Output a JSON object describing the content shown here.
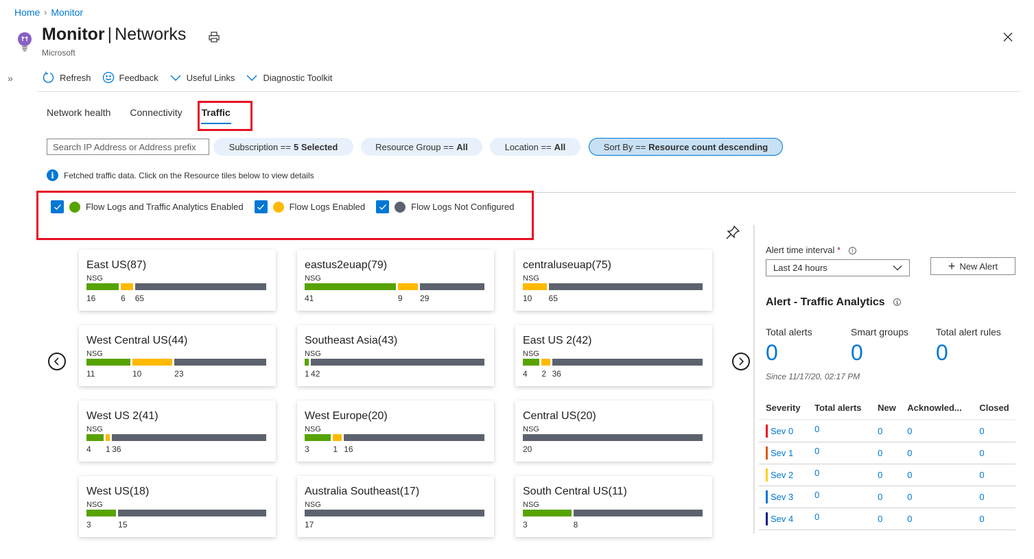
{
  "breadcrumb": [
    {
      "label": "Home"
    },
    {
      "label": "Monitor"
    }
  ],
  "header": {
    "title_main": "Monitor",
    "title_section": "Networks",
    "subtitle": "Microsoft"
  },
  "toolbar": {
    "refresh": "Refresh",
    "feedback": "Feedback",
    "useful_links": "Useful Links",
    "diagnostic_toolkit": "Diagnostic Toolkit"
  },
  "tabs": [
    {
      "label": "Network health",
      "active": false
    },
    {
      "label": "Connectivity",
      "active": false
    },
    {
      "label": "Traffic",
      "active": true
    }
  ],
  "filters": {
    "search_placeholder": "Search IP Address or Address prefix",
    "subscription": {
      "label": "Subscription ==",
      "value": "5 Selected"
    },
    "resource_group": {
      "label": "Resource Group ==",
      "value": "All"
    },
    "location": {
      "label": "Location ==",
      "value": "All"
    },
    "sort_by": {
      "label": "Sort By ==",
      "value": "Resource count descending"
    }
  },
  "info_message": "Fetched traffic data. Click on the Resource tiles below to view details",
  "legend": [
    {
      "label": "Flow Logs and Traffic Analytics Enabled",
      "checked": true,
      "color": "#57a300"
    },
    {
      "label": "Flow Logs Enabled",
      "checked": true,
      "color": "#ffb900"
    },
    {
      "label": "Flow Logs Not Configured",
      "checked": true,
      "color": "#5c636e"
    }
  ],
  "tile_resource_label": "NSG",
  "tiles": [
    {
      "name": "East US",
      "total": 87,
      "ta": 16,
      "fl": 6,
      "nc": 65
    },
    {
      "name": "eastus2euap",
      "total": 79,
      "ta": 41,
      "fl": 9,
      "nc": 29
    },
    {
      "name": "centraluseuap",
      "total": 75,
      "ta": 0,
      "fl": 10,
      "nc": 65
    },
    {
      "name": "West Central US",
      "total": 44,
      "ta": 11,
      "fl": 10,
      "nc": 23
    },
    {
      "name": "Southeast Asia",
      "total": 43,
      "ta": 1,
      "fl": 0,
      "nc": 42
    },
    {
      "name": "East US 2",
      "total": 42,
      "ta": 4,
      "fl": 2,
      "nc": 36
    },
    {
      "name": "West US 2",
      "total": 41,
      "ta": 4,
      "fl": 1,
      "nc": 36
    },
    {
      "name": "West Europe",
      "total": 20,
      "ta": 3,
      "fl": 1,
      "nc": 16
    },
    {
      "name": "Central US",
      "total": 20,
      "ta": 0,
      "fl": 0,
      "nc": 20
    },
    {
      "name": "West US",
      "total": 18,
      "ta": 3,
      "fl": 0,
      "nc": 15
    },
    {
      "name": "Australia Southeast",
      "total": 17,
      "ta": 0,
      "fl": 0,
      "nc": 17
    },
    {
      "name": "South Central US",
      "total": 11,
      "ta": 3,
      "fl": 0,
      "nc": 8
    }
  ],
  "alerts": {
    "interval_label": "Alert time interval",
    "interval_required": "*",
    "interval_value": "Last 24 hours",
    "new_alert": "New Alert",
    "title": "Alert - Traffic Analytics",
    "stats": [
      {
        "label": "Total alerts",
        "value": "0"
      },
      {
        "label": "Smart groups",
        "value": "0"
      },
      {
        "label": "Total alert rules",
        "value": "0"
      }
    ],
    "since": "Since 11/17/20, 02:17 PM",
    "columns": [
      "Severity",
      "Total alerts",
      "New",
      "Acknowled...",
      "Closed"
    ],
    "rows": [
      {
        "severity": "Sev 0",
        "color": "#e81123",
        "total": "0",
        "new": "0",
        "ack": "0",
        "closed": "0"
      },
      {
        "severity": "Sev 1",
        "color": "#da5b14",
        "total": "0",
        "new": "0",
        "ack": "0",
        "closed": "0"
      },
      {
        "severity": "Sev 2",
        "color": "#fcd116",
        "total": "0",
        "new": "0",
        "ack": "0",
        "closed": "0"
      },
      {
        "severity": "Sev 3",
        "color": "#0078d4",
        "total": "0",
        "new": "0",
        "ack": "0",
        "closed": "0"
      },
      {
        "severity": "Sev 4",
        "color": "#0b1a8c",
        "total": "0",
        "new": "0",
        "ack": "0",
        "closed": "0"
      }
    ]
  }
}
